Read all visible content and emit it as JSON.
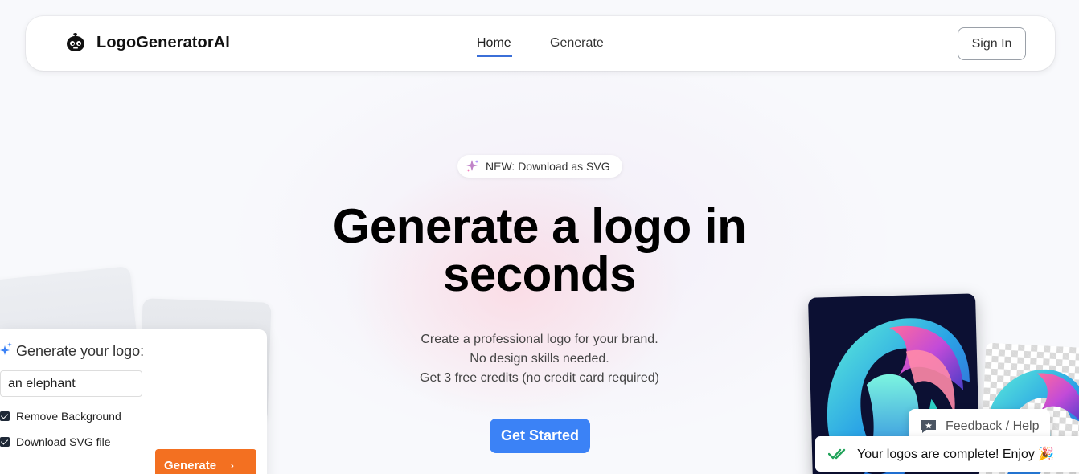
{
  "brand": {
    "name": "LogoGeneratorAI",
    "icon": "robot-head-icon"
  },
  "nav": {
    "home_label": "Home",
    "generate_label": "Generate",
    "active": "Home"
  },
  "header": {
    "signin_label": "Sign In"
  },
  "hero": {
    "badge_text": "NEW: Download as SVG",
    "badge_icon": "sparkles-icon",
    "title_line1": "Generate a logo in",
    "title_line2": "seconds",
    "subtitle": [
      "Create a professional logo for your brand.",
      "No design skills needed.",
      "Get 3 free credits (no credit card required)"
    ],
    "cta_label": "Get Started"
  },
  "demo": {
    "title": "Generate your logo:",
    "input_value": "an elephant",
    "checkbox_remove_bg": "Remove Background",
    "checkbox_remove_bg_checked": true,
    "checkbox_svg": "Download SVG file",
    "checkbox_svg_checked": true,
    "generate_label": "Generate"
  },
  "feedback": {
    "label": "Feedback / Help",
    "icon": "chat-star-icon"
  },
  "toast": {
    "message": "Your logos are complete! Enjoy 🎉",
    "icon": "double-check-icon"
  },
  "colors": {
    "accent_blue": "#3b82f6",
    "generate_orange": "#f37021",
    "nav_underline": "#3b6fd8",
    "toast_check": "#22a35a"
  }
}
